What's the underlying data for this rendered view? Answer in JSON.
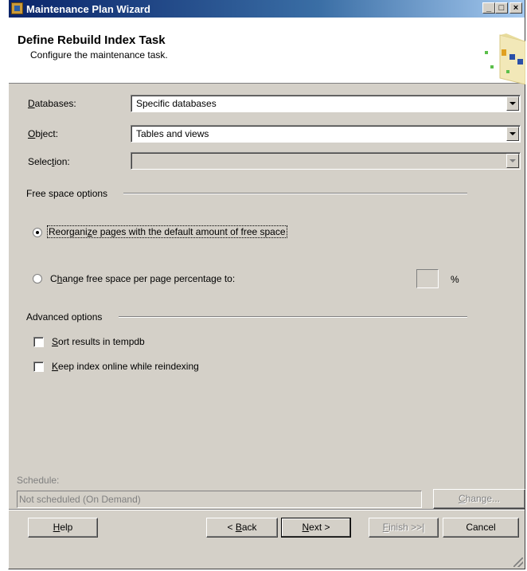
{
  "window": {
    "title": "Maintenance Plan Wizard",
    "controls": {
      "minimize": "_",
      "maximize": "□",
      "close": "×"
    }
  },
  "header": {
    "title": "Define Rebuild Index Task",
    "subtitle": "Configure the maintenance task."
  },
  "form": {
    "databases": {
      "label_pre": "",
      "label_key": "D",
      "label_post": "atabases:",
      "value": "Specific databases"
    },
    "object": {
      "label_pre": "",
      "label_key": "O",
      "label_post": "bject:",
      "value": "Tables and views"
    },
    "selection": {
      "label_pre": "Selec",
      "label_key": "t",
      "label_post": "ion:",
      "value": ""
    }
  },
  "free_space": {
    "group_label": "Free space options",
    "option1": {
      "pre": "Reorgani",
      "key": "z",
      "post": "e pages with the default amount of free space",
      "checked": true
    },
    "option2": {
      "pre": "C",
      "key": "h",
      "post": "ange free space per page percentage to:",
      "checked": false
    },
    "percent_symbol": "%"
  },
  "advanced": {
    "group_label": "Advanced options",
    "sort": {
      "pre": "",
      "key": "S",
      "post": "ort results in tempdb",
      "checked": false
    },
    "online": {
      "pre": "",
      "key": "K",
      "post": "eep index online while reindexing",
      "checked": false
    }
  },
  "schedule": {
    "label": "Schedule:",
    "value": "Not scheduled (On Demand)",
    "change_button": {
      "key": "C",
      "post": "hange..."
    }
  },
  "buttons": {
    "help": {
      "key": "H",
      "post": "elp"
    },
    "back": {
      "pre": "< ",
      "key": "B",
      "post": "ack"
    },
    "next": {
      "key": "N",
      "post": "ext >"
    },
    "finish": {
      "key": "F",
      "post": "inish >>|"
    },
    "cancel": "Cancel"
  }
}
